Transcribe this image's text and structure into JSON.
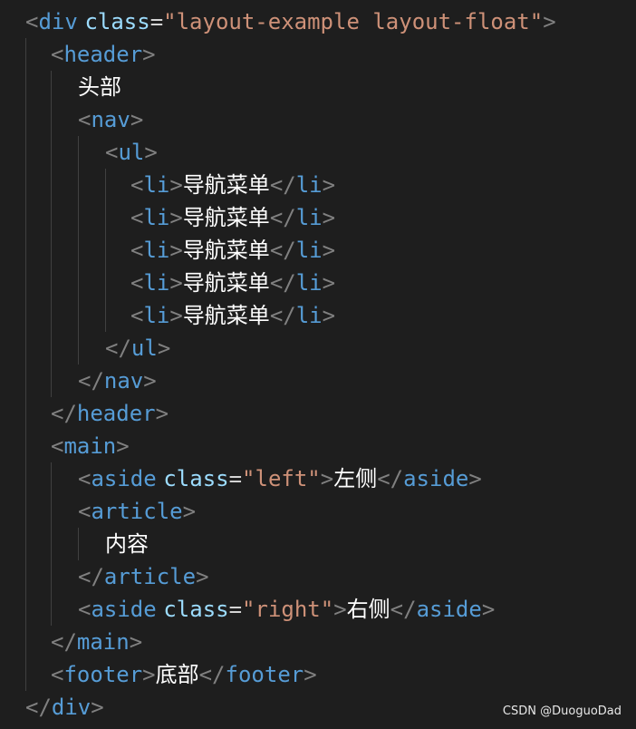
{
  "colors": {
    "background": "#1e1e1e",
    "punctuation": "#808080",
    "tag": "#569cd6",
    "attribute": "#9cdcfe",
    "string": "#ce9178",
    "text": "#ffffff"
  },
  "code": {
    "lines": [
      [
        {
          "t": "punc",
          "v": "<"
        },
        {
          "t": "tag",
          "v": "div"
        },
        {
          "t": "text",
          "v": " "
        },
        {
          "t": "attr",
          "v": "class"
        },
        {
          "t": "eq",
          "v": "="
        },
        {
          "t": "str",
          "v": "\"layout-example layout-float\""
        },
        {
          "t": "punc",
          "v": ">"
        }
      ],
      [
        {
          "t": "punc",
          "v": "<"
        },
        {
          "t": "tag",
          "v": "header"
        },
        {
          "t": "punc",
          "v": ">"
        }
      ],
      [
        {
          "t": "text",
          "v": "头部"
        }
      ],
      [
        {
          "t": "punc",
          "v": "<"
        },
        {
          "t": "tag",
          "v": "nav"
        },
        {
          "t": "punc",
          "v": ">"
        }
      ],
      [
        {
          "t": "punc",
          "v": "<"
        },
        {
          "t": "tag",
          "v": "ul"
        },
        {
          "t": "punc",
          "v": ">"
        }
      ],
      [
        {
          "t": "punc",
          "v": "<"
        },
        {
          "t": "tag",
          "v": "li"
        },
        {
          "t": "punc",
          "v": ">"
        },
        {
          "t": "text",
          "v": "导航菜单"
        },
        {
          "t": "punc",
          "v": "</"
        },
        {
          "t": "tag",
          "v": "li"
        },
        {
          "t": "punc",
          "v": ">"
        }
      ],
      [
        {
          "t": "punc",
          "v": "<"
        },
        {
          "t": "tag",
          "v": "li"
        },
        {
          "t": "punc",
          "v": ">"
        },
        {
          "t": "text",
          "v": "导航菜单"
        },
        {
          "t": "punc",
          "v": "</"
        },
        {
          "t": "tag",
          "v": "li"
        },
        {
          "t": "punc",
          "v": ">"
        }
      ],
      [
        {
          "t": "punc",
          "v": "<"
        },
        {
          "t": "tag",
          "v": "li"
        },
        {
          "t": "punc",
          "v": ">"
        },
        {
          "t": "text",
          "v": "导航菜单"
        },
        {
          "t": "punc",
          "v": "</"
        },
        {
          "t": "tag",
          "v": "li"
        },
        {
          "t": "punc",
          "v": ">"
        }
      ],
      [
        {
          "t": "punc",
          "v": "<"
        },
        {
          "t": "tag",
          "v": "li"
        },
        {
          "t": "punc",
          "v": ">"
        },
        {
          "t": "text",
          "v": "导航菜单"
        },
        {
          "t": "punc",
          "v": "</"
        },
        {
          "t": "tag",
          "v": "li"
        },
        {
          "t": "punc",
          "v": ">"
        }
      ],
      [
        {
          "t": "punc",
          "v": "<"
        },
        {
          "t": "tag",
          "v": "li"
        },
        {
          "t": "punc",
          "v": ">"
        },
        {
          "t": "text",
          "v": "导航菜单"
        },
        {
          "t": "punc",
          "v": "</"
        },
        {
          "t": "tag",
          "v": "li"
        },
        {
          "t": "punc",
          "v": ">"
        }
      ],
      [
        {
          "t": "punc",
          "v": "</"
        },
        {
          "t": "tag",
          "v": "ul"
        },
        {
          "t": "punc",
          "v": ">"
        }
      ],
      [
        {
          "t": "punc",
          "v": "</"
        },
        {
          "t": "tag",
          "v": "nav"
        },
        {
          "t": "punc",
          "v": ">"
        }
      ],
      [
        {
          "t": "punc",
          "v": "</"
        },
        {
          "t": "tag",
          "v": "header"
        },
        {
          "t": "punc",
          "v": ">"
        }
      ],
      [
        {
          "t": "punc",
          "v": "<"
        },
        {
          "t": "tag",
          "v": "main"
        },
        {
          "t": "punc",
          "v": ">"
        }
      ],
      [
        {
          "t": "punc",
          "v": "<"
        },
        {
          "t": "tag",
          "v": "aside"
        },
        {
          "t": "text",
          "v": " "
        },
        {
          "t": "attr",
          "v": "class"
        },
        {
          "t": "eq",
          "v": "="
        },
        {
          "t": "str",
          "v": "\"left\""
        },
        {
          "t": "punc",
          "v": ">"
        },
        {
          "t": "text",
          "v": "左侧"
        },
        {
          "t": "punc",
          "v": "</"
        },
        {
          "t": "tag",
          "v": "aside"
        },
        {
          "t": "punc",
          "v": ">"
        }
      ],
      [
        {
          "t": "punc",
          "v": "<"
        },
        {
          "t": "tag",
          "v": "article"
        },
        {
          "t": "punc",
          "v": ">"
        }
      ],
      [
        {
          "t": "text",
          "v": "内容"
        }
      ],
      [
        {
          "t": "punc",
          "v": "</"
        },
        {
          "t": "tag",
          "v": "article"
        },
        {
          "t": "punc",
          "v": ">"
        }
      ],
      [
        {
          "t": "punc",
          "v": "<"
        },
        {
          "t": "tag",
          "v": "aside"
        },
        {
          "t": "text",
          "v": " "
        },
        {
          "t": "attr",
          "v": "class"
        },
        {
          "t": "eq",
          "v": "="
        },
        {
          "t": "str",
          "v": "\"right\""
        },
        {
          "t": "punc",
          "v": ">"
        },
        {
          "t": "text",
          "v": "右侧"
        },
        {
          "t": "punc",
          "v": "</"
        },
        {
          "t": "tag",
          "v": "aside"
        },
        {
          "t": "punc",
          "v": ">"
        }
      ],
      [
        {
          "t": "punc",
          "v": "</"
        },
        {
          "t": "tag",
          "v": "main"
        },
        {
          "t": "punc",
          "v": ">"
        }
      ],
      [
        {
          "t": "punc",
          "v": "<"
        },
        {
          "t": "tag",
          "v": "footer"
        },
        {
          "t": "punc",
          "v": ">"
        },
        {
          "t": "text",
          "v": "底部"
        },
        {
          "t": "punc",
          "v": "</"
        },
        {
          "t": "tag",
          "v": "footer"
        },
        {
          "t": "punc",
          "v": ">"
        }
      ],
      [
        {
          "t": "punc",
          "v": "</"
        },
        {
          "t": "tag",
          "v": "div"
        },
        {
          "t": "punc",
          "v": ">"
        }
      ]
    ]
  },
  "watermark": "CSDN @DuoguoDad"
}
